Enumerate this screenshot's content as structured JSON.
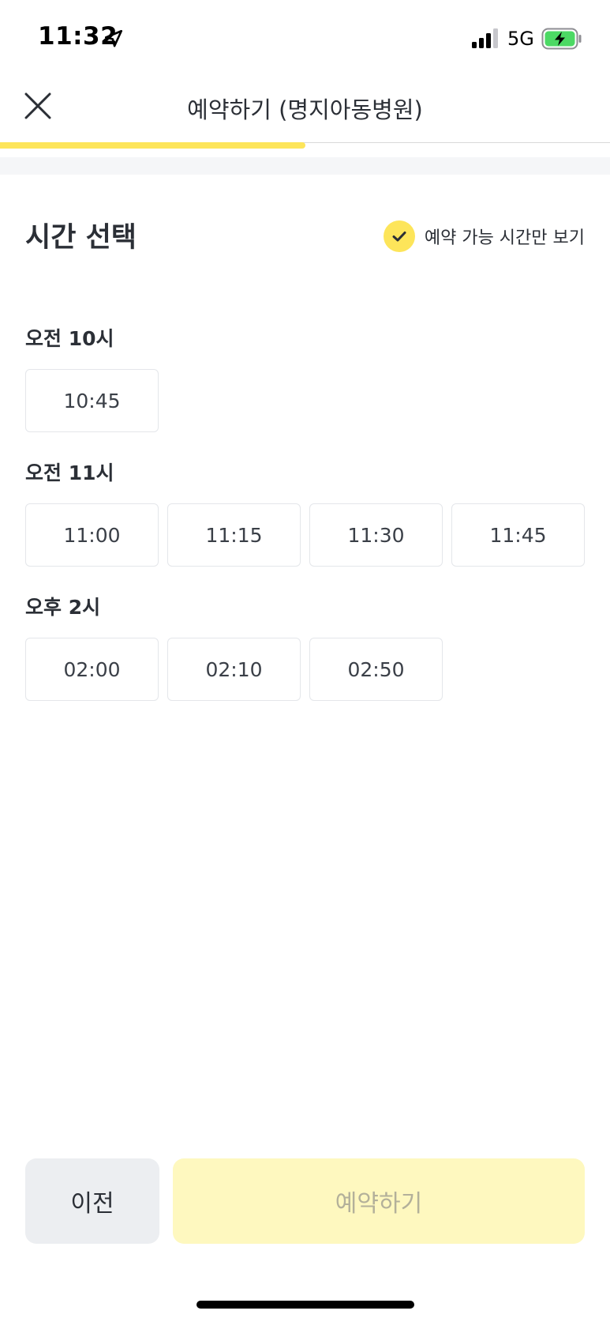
{
  "status_bar": {
    "time": "11:32",
    "network": "5G",
    "icons": [
      "location-arrow-icon",
      "signal-icon",
      "battery-charging-icon"
    ],
    "battery_color": "#4cd964"
  },
  "header": {
    "title": "예약하기 (명지아동병원)",
    "close_icon": "close-icon",
    "progress": 0.5
  },
  "section": {
    "title": "시간 선택",
    "filter_label": "예약 가능 시간만 보기",
    "filter_checked": true
  },
  "groups": [
    {
      "label": "오전 10시",
      "slots": [
        "10:45"
      ]
    },
    {
      "label": "오전 11시",
      "slots": [
        "11:00",
        "11:15",
        "11:30",
        "11:45"
      ]
    },
    {
      "label": "오후 2시",
      "slots": [
        "02:00",
        "02:10",
        "02:50"
      ]
    }
  ],
  "footer": {
    "prev_label": "이전",
    "submit_label": "예약하기"
  },
  "colors": {
    "accent": "#fde55a",
    "accent_light": "#fef8bf",
    "text": "#2b2f36",
    "button_gray": "#eceef1"
  }
}
